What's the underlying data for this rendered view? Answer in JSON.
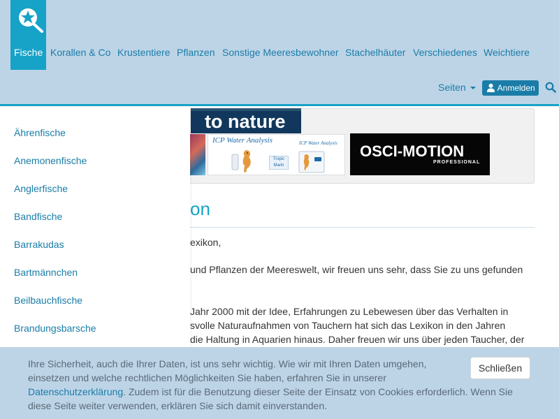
{
  "nav": {
    "items": [
      "Fische",
      "Korallen & Co",
      "Krustentiere",
      "Pflanzen",
      "Sonstige Meeresbewohner",
      "Stachelhäuter",
      "Verschiedenes",
      "Weichtiere"
    ],
    "seiten_label": "Seiten",
    "login_label": "Anmelden"
  },
  "ads": {
    "nature_text": "to nature",
    "icp_title": "ICP Water Analysis",
    "icp_plus": "Plus",
    "icp_brand": "Tropic Marin",
    "icp_title_small": "ICP Water Analysis",
    "osci_text": "OSCI-MOTION",
    "osci_sub": "PROFESSIONAL"
  },
  "main": {
    "heading": "on",
    "paragraphs": [
      "exikon,",
      "und Pflanzen der Meereswelt, wir freuen uns sehr, dass Sie zu uns gefunden",
      "Jahr 2000 mit der Idee, Erfahrungen zu Lebewesen über das Verhalten in",
      "svolle Naturaufnahmen von Tauchern hat sich das Lexikon in den Jahren",
      "die Haltung in Aquarien hinaus. Daher freuen wir uns über jeden Taucher, der"
    ]
  },
  "sidebar": {
    "items": [
      "Ährenfische",
      "Anemonenfische",
      "Anglerfische",
      "Bandfische",
      "Barrakudas",
      "Bartmännchen",
      "Beilbauchfische",
      "Brandungsbarsche"
    ]
  },
  "cookie": {
    "line1": "Ihre Sicherheit, auch die Ihrer Daten, ist uns sehr wichtig. Wie wir mit Ihren Daten umgehen,",
    "line2": "einsetzen und welche rechtlichen Möglichkeiten Sie haben, erfahren Sie in unserer",
    "link": "Datenschutzerklärung",
    "line3_rest": ". Zudem ist für die Benutzung dieser Seite der Einsatz von Cookies erforderlich. Wenn Sie",
    "line4": "diese Seite weiter verwenden, erklären Sie sich damit einverstanden.",
    "close_label": "Schließen"
  },
  "colors": {
    "header_bg": "#bdd4e7",
    "accent": "#17a2c7",
    "link": "#1a7da8"
  }
}
